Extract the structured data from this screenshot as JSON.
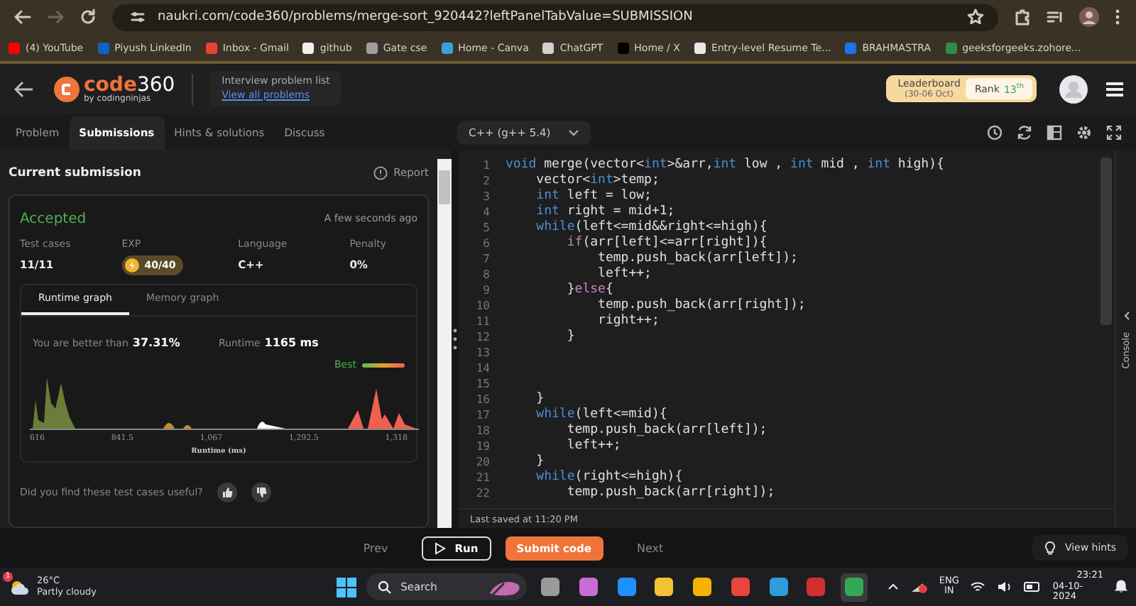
{
  "browser": {
    "url": "naukri.com/code360/problems/merge-sort_920442?leftPanelTabValue=SUBMISSION",
    "bookmarks": [
      {
        "label": "(4) YouTube",
        "color": "#ff0000"
      },
      {
        "label": "Piyush LinkedIn",
        "color": "#0a66c2"
      },
      {
        "label": "Inbox - Gmail",
        "color": "#ea4335"
      },
      {
        "label": "github",
        "color": "#f0f0f0"
      },
      {
        "label": "Gate cse",
        "color": "#9e9e9e"
      },
      {
        "label": "Home - Canva",
        "color": "#3aa1d8"
      },
      {
        "label": "ChatGPT",
        "color": "#d0d0d0"
      },
      {
        "label": "Home / X",
        "color": "#000000"
      },
      {
        "label": "Entry-level Resume Te...",
        "color": "#e8e8e8"
      },
      {
        "label": "BRAHMASTRA",
        "color": "#1a73e8"
      },
      {
        "label": "geeksforgeeks.zohore...",
        "color": "#2f8d46"
      }
    ]
  },
  "header": {
    "logo_name": "code",
    "logo_number": "360",
    "logo_sub": "by codingninjas",
    "problem_list": {
      "title": "Interview problem list",
      "link": "View all problems"
    },
    "leaderboard": {
      "title": "Leaderboard",
      "dates": "(30-06 Oct)",
      "rank_label": "Rank",
      "rank_value": "13$^{th}$"
    }
  },
  "tabs": [
    {
      "label": "Problem",
      "selected": false
    },
    {
      "label": "Submissions",
      "selected": true
    },
    {
      "label": "Hints & solutions",
      "selected": false
    },
    {
      "label": "Discuss",
      "selected": false
    }
  ],
  "language": "C++ (g++ 5.4)",
  "submission": {
    "title": "Current submission",
    "report": "Report",
    "status": "Accepted",
    "time": "A few seconds ago",
    "stats": [
      {
        "label": "Test cases",
        "value": "11/11",
        "kind": "text"
      },
      {
        "label": "EXP",
        "value": "40/40",
        "kind": "badge"
      },
      {
        "label": "Language",
        "value": "C++",
        "kind": "text"
      },
      {
        "label": "Penalty",
        "value": "0%",
        "kind": "text"
      }
    ],
    "graph_tabs": [
      {
        "label": "Runtime graph",
        "selected": true
      },
      {
        "label": "Memory graph",
        "selected": false
      }
    ],
    "better_label": "You are better than",
    "better_value": "37.31%",
    "runtime_label": "Runtime",
    "runtime_value": "1165 ms",
    "legend": "Best",
    "ticks": [
      "616",
      "841.5",
      "1,067",
      "1,292.5",
      "1,318"
    ],
    "xlabel": "Runtime (ms)",
    "feedback": "Did you find these test cases useful?"
  },
  "editor": {
    "lines": [
      {
        "number": "1",
        "segments": [
          {
            "text": "void",
            "kind": "keyword"
          },
          {
            "text": " merge(vector<",
            "kind": "plain"
          },
          {
            "text": "int",
            "kind": "keyword"
          },
          {
            "text": ">&arr,",
            "kind": "plain"
          },
          {
            "text": "int",
            "kind": "keyword"
          },
          {
            "text": " low , ",
            "kind": "plain"
          },
          {
            "text": "int",
            "kind": "keyword"
          },
          {
            "text": " mid , ",
            "kind": "plain"
          },
          {
            "text": "int",
            "kind": "keyword"
          },
          {
            "text": " high){",
            "kind": "plain"
          }
        ]
      },
      {
        "number": "2",
        "segments": [
          {
            "text": "    vector<",
            "kind": "plain"
          },
          {
            "text": "int",
            "kind": "keyword"
          },
          {
            "text": ">temp;",
            "kind": "plain"
          }
        ]
      },
      {
        "number": "3",
        "segments": [
          {
            "text": "    int",
            "kind": "keyword"
          },
          {
            "text": " left = low;",
            "kind": "plain"
          }
        ]
      },
      {
        "number": "4",
        "segments": [
          {
            "text": "    int",
            "kind": "keyword"
          },
          {
            "text": " right = mid+1;",
            "kind": "plain"
          }
        ]
      },
      {
        "number": "5",
        "segments": [
          {
            "text": "    while",
            "kind": "keyword"
          },
          {
            "text": "(left<=mid&&right<=high){",
            "kind": "plain"
          }
        ]
      },
      {
        "number": "6",
        "segments": [
          {
            "text": "        if",
            "kind": "control"
          },
          {
            "text": "(arr[left]<=arr[right]){",
            "kind": "plain"
          }
        ]
      },
      {
        "number": "7",
        "segments": [
          {
            "text": "            temp.push_back(arr[left]);",
            "kind": "plain"
          }
        ]
      },
      {
        "number": "8",
        "segments": [
          {
            "text": "            left++;",
            "kind": "plain"
          }
        ]
      },
      {
        "number": "9",
        "segments": [
          {
            "text": "        }",
            "kind": "plain"
          },
          {
            "text": "else",
            "kind": "control"
          },
          {
            "text": "{",
            "kind": "plain"
          }
        ]
      },
      {
        "number": "10",
        "segments": [
          {
            "text": "            temp.push_back(arr[right]);",
            "kind": "plain"
          }
        ]
      },
      {
        "number": "11",
        "segments": [
          {
            "text": "            right++;",
            "kind": "plain"
          }
        ]
      },
      {
        "number": "12",
        "segments": [
          {
            "text": "        }",
            "kind": "plain"
          }
        ]
      },
      {
        "number": "13"
      },
      {
        "number": "14"
      },
      {
        "number": "15"
      },
      {
        "number": "16",
        "segments": [
          {
            "text": "    }",
            "kind": "plain"
          }
        ]
      },
      {
        "number": "17",
        "segments": [
          {
            "text": "    while",
            "kind": "keyword"
          },
          {
            "text": "(left<=mid){",
            "kind": "plain"
          }
        ]
      },
      {
        "number": "18",
        "segments": [
          {
            "text": "        temp.push_back(arr[left]);",
            "kind": "plain"
          }
        ]
      },
      {
        "number": "19",
        "segments": [
          {
            "text": "        left++;",
            "kind": "plain"
          }
        ]
      },
      {
        "number": "20",
        "segments": [
          {
            "text": "    }",
            "kind": "plain"
          }
        ]
      },
      {
        "number": "21",
        "segments": [
          {
            "text": "    while",
            "kind": "keyword"
          },
          {
            "text": "(right<=high){",
            "kind": "plain"
          }
        ]
      },
      {
        "number": "22",
        "segments": [
          {
            "text": "        temp.push_back(arr[right]);",
            "kind": "plain"
          }
        ]
      }
    ],
    "last_saved": "Last saved at 11:20 PM",
    "console": "Console"
  },
  "footer": {
    "prev": "Prev",
    "run": "Run",
    "submit": "Submit code",
    "next": "Next",
    "hints": "View hints"
  },
  "taskbar": {
    "temperature": "26°C",
    "weather": "Partly cloudy",
    "weather_badge": "1",
    "search": "Search",
    "apps": [
      {
        "color": "#9a9a9a"
      },
      {
        "color": "#c86dd7"
      },
      {
        "color": "#1e90ff"
      },
      {
        "color": "#f1c232"
      },
      {
        "color": "#f4b400"
      },
      {
        "color": "#e8453c"
      },
      {
        "color": "#2d9cdb"
      },
      {
        "color": "#d32f2f"
      },
      {
        "color": "#34a853",
        "selected": true
      }
    ],
    "language": "ENG",
    "region": "IN",
    "time": "23:21",
    "date": "04-10-2024"
  }
}
